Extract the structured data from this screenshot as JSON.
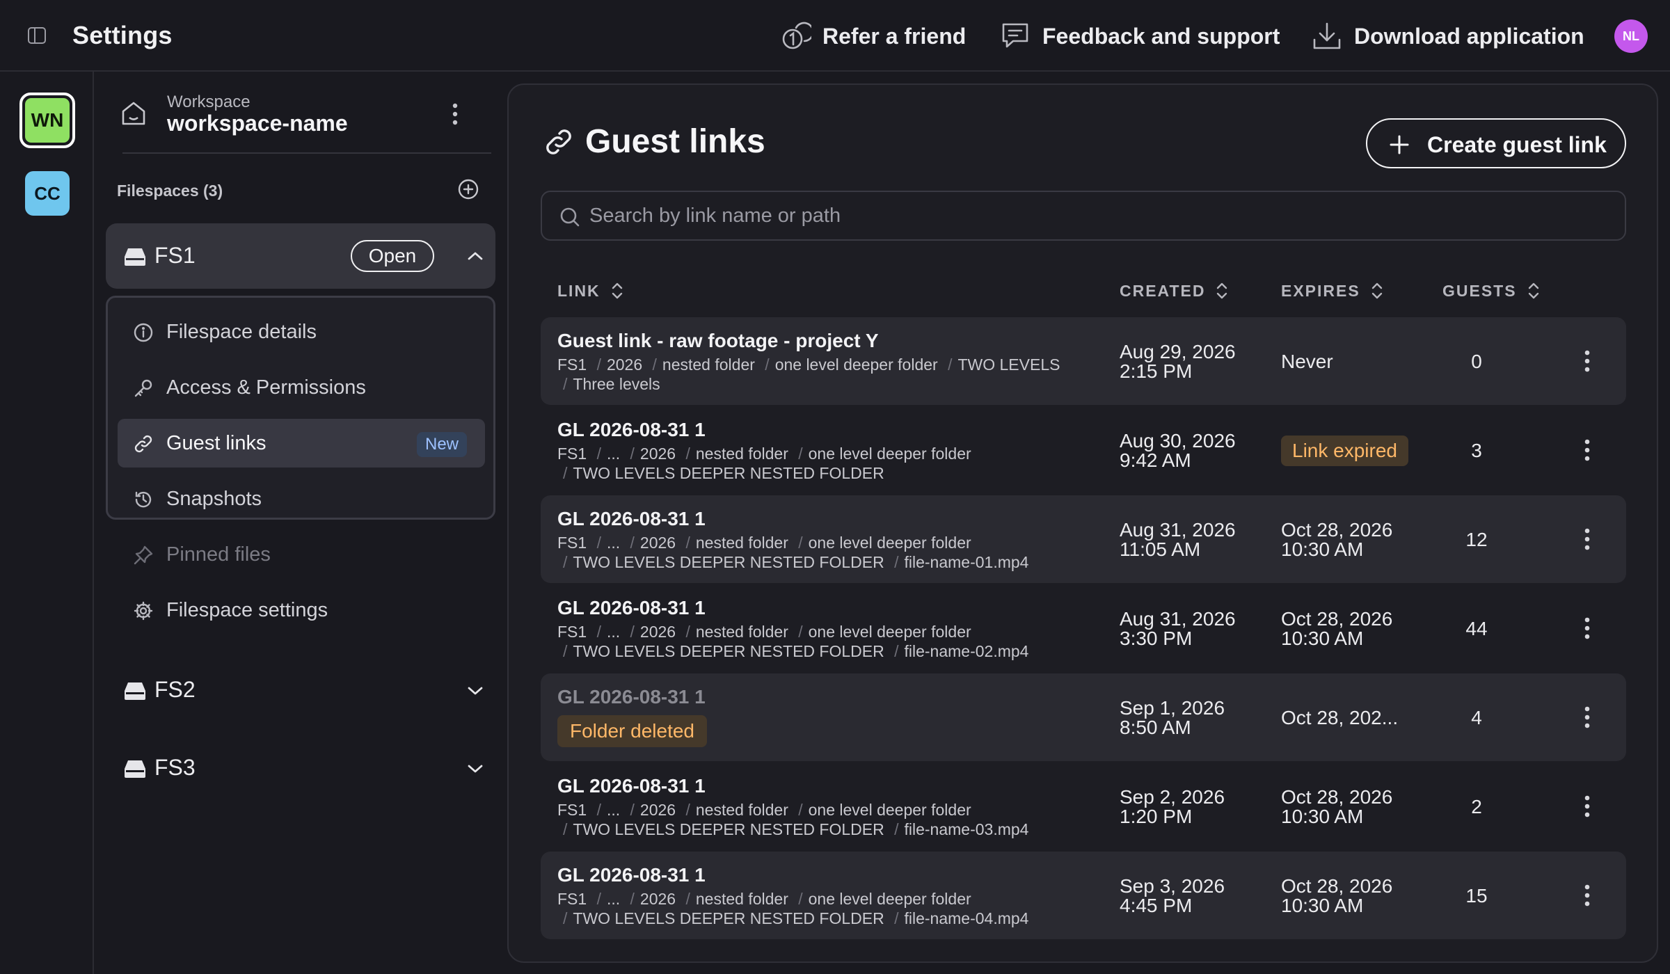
{
  "app": {
    "title": "Settings",
    "actions": {
      "refer": "Refer a friend",
      "feedback": "Feedback and support",
      "download": "Download application"
    },
    "user_initials": "NL"
  },
  "rail": {
    "workspaces": [
      {
        "initials": "WN",
        "color": "#8fe062"
      },
      {
        "initials": "CC",
        "color": "#6fc6ee"
      }
    ]
  },
  "sidebar": {
    "workspace_label": "Workspace",
    "workspace_name": "workspace-name",
    "filespaces_label": "Filespaces (3)",
    "filespaces": [
      {
        "name": "FS1",
        "status": "Open",
        "expanded": true
      },
      {
        "name": "FS2",
        "expanded": false
      },
      {
        "name": "FS3",
        "expanded": false
      }
    ],
    "menu": [
      {
        "label": "Filespace details",
        "icon": "info-icon"
      },
      {
        "label": "Access & Permissions",
        "icon": "key-icon"
      },
      {
        "label": "Guest links",
        "icon": "link-icon",
        "badge": "New",
        "active": true
      },
      {
        "label": "Snapshots",
        "icon": "history-icon"
      },
      {
        "label": "Pinned files",
        "icon": "pin-icon",
        "disabled": true
      },
      {
        "label": "Filespace settings",
        "icon": "gear-icon"
      }
    ]
  },
  "main": {
    "title": "Guest links",
    "create_label": "Create guest link",
    "search_placeholder": "Search by link name or path",
    "columns": {
      "link": "LINK",
      "created": "CREATED",
      "expires": "EXPIRES",
      "guests": "GUESTS"
    },
    "rows": [
      {
        "name": "Guest link - raw footage - project Y",
        "path": [
          "FS1",
          "2026",
          "nested folder",
          "one level deeper folder",
          "TWO LEVELS",
          "Three levels"
        ],
        "created": [
          "Aug 29, 2026",
          "2:15 PM"
        ],
        "expires": [
          "Never"
        ],
        "guests": "0"
      },
      {
        "name": "GL 2026-08-31 1",
        "path": [
          "FS1",
          "...",
          "2026",
          "nested folder",
          "one level deeper folder",
          "TWO LEVELS  DEEPER NESTED FOLDER"
        ],
        "created": [
          "Aug 30, 2026",
          "9:42 AM"
        ],
        "expires_badge": "Link expired",
        "guests": "3"
      },
      {
        "name": "GL 2026-08-31 1",
        "path": [
          "FS1",
          "...",
          "2026",
          "nested folder",
          "one level deeper folder",
          "TWO LEVELS  DEEPER NESTED FOLDER",
          "file-name-01.mp4"
        ],
        "created": [
          "Aug 31, 2026",
          "11:05 AM"
        ],
        "expires": [
          "Oct 28, 2026",
          "10:30 AM"
        ],
        "guests": "12"
      },
      {
        "name": "GL 2026-08-31 1",
        "path": [
          "FS1",
          "...",
          "2026",
          "nested folder",
          "one level deeper folder",
          "TWO LEVELS  DEEPER NESTED FOLDER",
          "file-name-02.mp4"
        ],
        "created": [
          "Aug 31, 2026",
          "3:30 PM"
        ],
        "expires": [
          "Oct 28, 2026",
          "10:30 AM"
        ],
        "guests": "44"
      },
      {
        "name": "GL 2026-08-31 1",
        "deleted_badge": "Folder deleted",
        "created": [
          "Sep 1, 2026",
          "8:50 AM"
        ],
        "expires": [
          "Oct 28, 202..."
        ],
        "guests": "4"
      },
      {
        "name": "GL 2026-08-31 1",
        "path": [
          "FS1",
          "...",
          "2026",
          "nested folder",
          "one level deeper folder",
          "TWO LEVELS  DEEPER NESTED FOLDER",
          "file-name-03.mp4"
        ],
        "created": [
          "Sep 2, 2026",
          "1:20 PM"
        ],
        "expires": [
          "Oct 28, 2026",
          "10:30 AM"
        ],
        "guests": "2"
      },
      {
        "name": "GL 2026-08-31 1",
        "path": [
          "FS1",
          "...",
          "2026",
          "nested folder",
          "one level deeper folder",
          "TWO LEVELS  DEEPER NESTED FOLDER",
          "file-name-04.mp4"
        ],
        "created": [
          "Sep 3, 2026",
          "4:45 PM"
        ],
        "expires": [
          "Oct 28, 2026",
          "10:30 AM"
        ],
        "guests": "15"
      }
    ]
  }
}
